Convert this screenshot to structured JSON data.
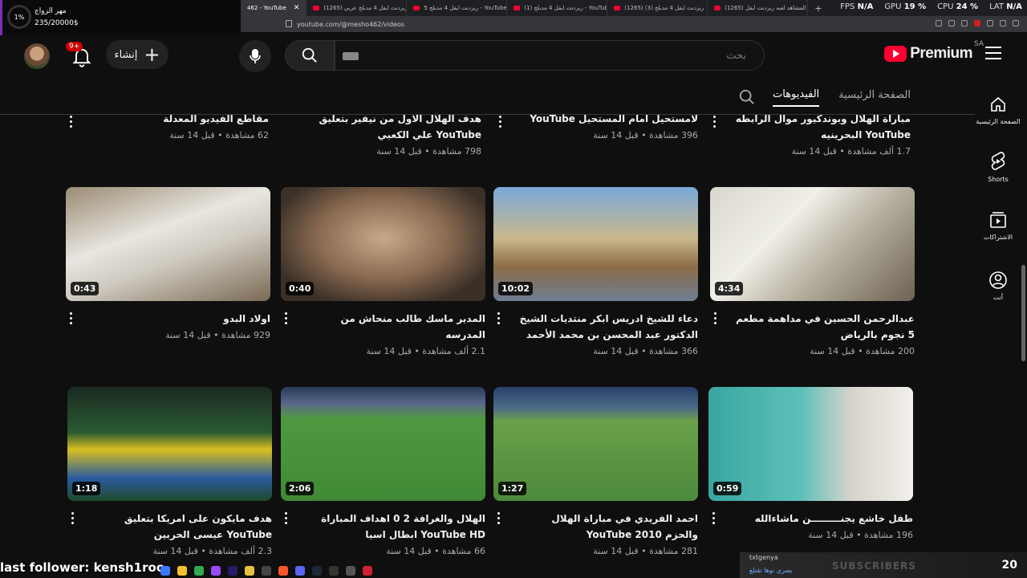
{
  "browser": {
    "tabs": [
      {
        "label": "(1265) جميع المشاهد لعبه ريزدنت ايفل",
        "active": false
      },
      {
        "label": "ريزدنت ايفل 4 مدبلج (3) (1265)",
        "active": false
      },
      {
        "label": "ريزدنت ايفل 4 مدبلج (1) - YouTube",
        "active": false
      },
      {
        "label": "ريزدنت ايفل 4 مدبلج 5 - YouTube",
        "active": false
      },
      {
        "label": "(1265) ريزدنت ايفل 4 مدبلج عربي",
        "active": false
      },
      {
        "label": "462 - YouTube",
        "active": true
      }
    ],
    "url": "youtube.com/@mesho462/videos",
    "stats": {
      "fps_label": "FPS",
      "fps_value": "N/A",
      "gpu_label": "GPU",
      "gpu_value": "19 %",
      "cpu_label": "CPU",
      "cpu_value": "24 %",
      "lat_label": "LAT",
      "lat_value": "N/A"
    }
  },
  "donation": {
    "percent": "1%",
    "title": "مهر الزواج",
    "amount": "235/20000$"
  },
  "header": {
    "brand": "Premium",
    "region": "SA",
    "search_placeholder": "بحث",
    "create_label": "إنشاء",
    "notif_badge": "9+"
  },
  "guide": [
    {
      "label": "الصفحة الرئيسية",
      "icon": "home-icon"
    },
    {
      "label": "Shorts",
      "icon": "shorts-icon"
    },
    {
      "label": "الاشتراكات",
      "icon": "subscriptions-icon"
    },
    {
      "label": "أنت",
      "icon": "you-icon"
    }
  ],
  "channel_tabs": [
    {
      "label": "الصفحة الرئيسية",
      "active": false
    },
    {
      "label": "الفيديوهات",
      "active": true
    }
  ],
  "partial_row": [
    {
      "title": "مباراة الهلال وبوندكيور موال الرابطه YouTube البحرينيه",
      "meta": "1.7 ألف مشاهدة • قبل 14 سنة"
    },
    {
      "title": "لامستحيل امام المستحيل YouTube",
      "meta": "396 مشاهدة • قبل 14 سنة"
    },
    {
      "title": "هدف الهلال الاول من نيفير بتعليق YouTube علي الكعبي",
      "meta": "798 مشاهدة • قبل 14 سنة"
    },
    {
      "title": "مقاطع الفيديو المعدلة",
      "meta": "62 مشاهدة • قبل 14 سنة"
    }
  ],
  "videos": [
    {
      "title": "عبدالرحمن الحسين في مداهمة مطعم 5 نجوم بالرياض",
      "meta": "200 مشاهدة • قبل 14 سنة",
      "duration": "4:34"
    },
    {
      "title": "دعاء للشيخ ادريس ابكر منتديات الشيخ الدكتور عبد المحسن بن محمد الأحمد",
      "meta": "366 مشاهدة • قبل 14 سنة",
      "duration": "10:02"
    },
    {
      "title": "المدير ماسك طالب منحاش من المدرسه",
      "meta": "2.1 ألف مشاهدة • قبل 14 سنة",
      "duration": "0:40"
    },
    {
      "title": "اولاد البدو",
      "meta": "929 مشاهدة • قبل 14 سنة",
      "duration": "0:43"
    },
    {
      "title": "طفل خاشع يجنـــــــــن ماشاءالله",
      "meta": "196 مشاهدة • قبل 14 سنة",
      "duration": "0:59"
    },
    {
      "title": "احمد الفريدي في مباراة الهلال والحزم YouTube 2010",
      "meta": "281 مشاهدة • قبل 14 سنة",
      "duration": "1:27"
    },
    {
      "title": "الهلال والغرافة 2 0 اهداف المباراة YouTube HD ابطال اسيا",
      "meta": "66 مشاهدة • قبل 14 سنة",
      "duration": "2:06"
    },
    {
      "title": "هدف مايكون على امريكا بتعليق YouTube عيسى الحربين",
      "meta": "2.3 ألف مشاهدة • قبل 14 سنة",
      "duration": "1:18"
    }
  ],
  "overlay": {
    "last_follower": "last follower: kensh1roo",
    "subscribers_label": "SUBSCRIBERS",
    "subscribers_count": "20",
    "chat_user": "txtgenya",
    "chat_message": "يصري نوها تقتلع"
  }
}
